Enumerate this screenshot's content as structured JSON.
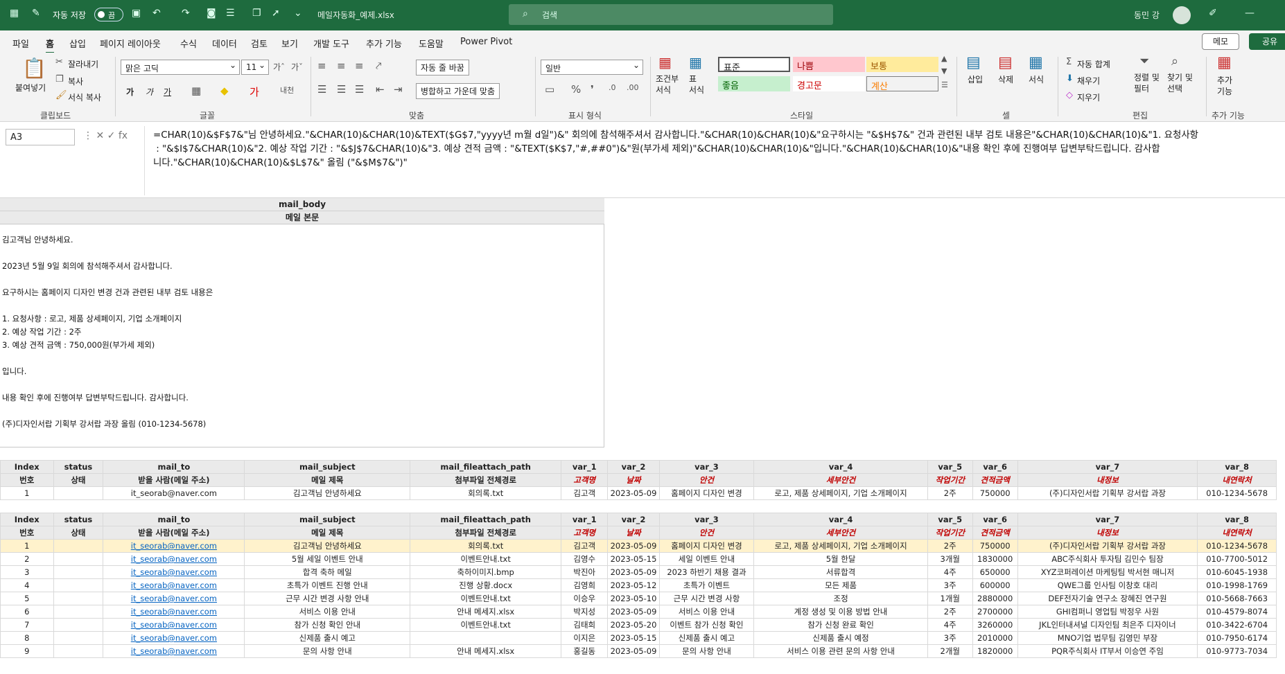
{
  "titlebar": {
    "autosave_label": "자동 저장",
    "autosave_state": "끔",
    "filename": "메일자동화_예제.xlsx",
    "search_placeholder": "검색",
    "user_name": "동민 강"
  },
  "menu": {
    "tabs": [
      "파일",
      "홈",
      "삽입",
      "페이지 레이아웃",
      "수식",
      "데이터",
      "검토",
      "보기",
      "개발 도구",
      "추가 기능",
      "도움말",
      "Power Pivot"
    ],
    "active": "홈",
    "memo_label": "메모",
    "share_label": "공유"
  },
  "ribbon": {
    "clipboard": {
      "paste": "붙여넣기",
      "cut": "잘라내기",
      "copy": "복사",
      "format_painter": "서식 복사",
      "group": "클립보드"
    },
    "font": {
      "name": "맑은 고딕",
      "size": "11",
      "bold": "가",
      "italic": "가",
      "underline": "가",
      "group": "글꼴"
    },
    "align": {
      "wrap": "자동 줄 바꿈",
      "merge": "병합하고 가운데 맞춤",
      "group": "맞춤"
    },
    "number": {
      "format": "일반",
      "group": "표시 형식"
    },
    "styles": {
      "cond": "조건부\n서식",
      "table": "표\n서식",
      "cells": [
        "표준",
        "나쁨",
        "보통",
        "좋음",
        "경고문",
        "계산"
      ],
      "group": "스타일"
    },
    "cells_group": {
      "insert": "삽입",
      "delete": "삭제",
      "format": "서식",
      "group": "셀"
    },
    "edit": {
      "autosum": "자동 합계",
      "fill": "채우기",
      "clear": "지우기",
      "sort": "정렬 및\n필터",
      "find": "찾기 및\n선택",
      "group": "편집"
    },
    "addins": {
      "label": "추가\n기능",
      "group": "추가 기능"
    }
  },
  "formula_bar": {
    "name_box": "A3",
    "formula_lines": [
      "=CHAR(10)&$F$7&\"님 안녕하세요.\"&CHAR(10)&CHAR(10)&TEXT($G$7,\"yyyy년 m월 d일\")&\" 회의에 참석해주셔서 감사합니다.\"&CHAR(10)&CHAR(10)&\"요구하시는 \"&$H$7&\" 건과 관련된 내부 검토 내용은\"&CHAR(10)&CHAR(10)&\"1. 요청사항 : \"&$I$7&CHAR(10)&\"2. 예상 작업 기간 : \"&$J$7&CHAR(10)&\"3. 예상 견적 금액 : \"&TEXT($K$7,\"#,##0\")&\"원(부가세 제외)\"&CHAR(10)&CHAR(10)&\"입니다.\"&CHAR(10)&CHAR(10)&\"내용 확인 후에 진행여부 답변부탁드립니다. 감사합니다.\"&CHAR(10)&CHAR(10)&$L$7&\" 올림 (\"&$M$7&\")\""
    ]
  },
  "mail_body": {
    "header1": "mail_body",
    "header2": "메일 본문",
    "lines": [
      "김고객님 안녕하세요.",
      "",
      "2023년 5월 9일 회의에 참석해주셔서 감사합니다.",
      "",
      "요구하시는 홈페이지 디자인 변경 건과 관련된 내부 검토 내용은",
      "",
      "1. 요청사항 : 로고, 제품 상세페이지, 기업 소개페이지",
      "2. 예상 작업 기간 : 2주",
      "3. 예상 견적 금액 : 750,000원(부가세 제외)",
      "",
      "입니다.",
      "",
      "내용 확인 후에 진행여부 답변부탁드립니다. 감사합니다.",
      "",
      "(주)디자인서랍 기획부 강서랍 과장 올림 (010-1234-5678)"
    ]
  },
  "columns": {
    "h1": [
      "Index",
      "status",
      "mail_to",
      "mail_subject",
      "mail_fileattach_path",
      "var_1",
      "var_2",
      "var_3",
      "var_4",
      "var_5",
      "var_6",
      "var_7",
      "var_8"
    ],
    "h2": [
      "번호",
      "상태",
      "받을 사람(메일 주소)",
      "메일 제목",
      "첨부파일 전체경로",
      "고객명",
      "날짜",
      "안건",
      "세부안건",
      "작업기간",
      "견적금액",
      "내정보",
      "내연락처"
    ]
  },
  "table1_rows": [
    [
      "1",
      "",
      "it_seorab@naver.com",
      "김고객님 안녕하세요",
      "회의록.txt",
      "김고객",
      "2023-05-09",
      "홈페이지 디자인 변경",
      "로고, 제품 상세페이지, 기업 소개페이지",
      "2주",
      "750000",
      "(주)디자인서랍 기획부 강서랍 과장",
      "010-1234-5678"
    ]
  ],
  "table2_rows": [
    [
      "1",
      "",
      "it_seorab@naver.com",
      "김고객님 안녕하세요",
      "회의록.txt",
      "김고객",
      "2023-05-09",
      "홈페이지 디자인 변경",
      "로고, 제품 상세페이지, 기업 소개페이지",
      "2주",
      "750000",
      "(주)디자인서랍 기획부 강서랍 과장",
      "010-1234-5678"
    ],
    [
      "2",
      "",
      "it_seorab@naver.com",
      "5월 세일 이벤트 안내",
      "이벤트안내.txt",
      "김영수",
      "2023-05-15",
      "세일 이벤트 안내",
      "5월 한달",
      "3개월",
      "1830000",
      "ABC주식회사 투자팀 김민수 팀장",
      "010-7700-5012"
    ],
    [
      "3",
      "",
      "it_seorab@naver.com",
      "합격 축하 메일",
      "축하이미지.bmp",
      "박진아",
      "2023-05-09",
      "2023 하반기 채용 결과",
      "서류합격",
      "4주",
      "650000",
      "XYZ코퍼레이션 마케팅팀 박서현 매니저",
      "010-6045-1938"
    ],
    [
      "4",
      "",
      "it_seorab@naver.com",
      "초특가 이벤트 진행 안내",
      "진행 상황.docx",
      "김영희",
      "2023-05-12",
      "초특가 이벤트",
      "모든 제품",
      "3주",
      "600000",
      "QWE그룹 인사팀 이창호 대리",
      "010-1998-1769"
    ],
    [
      "5",
      "",
      "it_seorab@naver.com",
      "근무 시간 변경 사항 안내",
      "이벤트안내.txt",
      "이승우",
      "2023-05-10",
      "근무 시간 변경 사항",
      "조정",
      "1개월",
      "2880000",
      "DEF전자기술 연구소 장혜진 연구원",
      "010-5668-7663"
    ],
    [
      "6",
      "",
      "it_seorab@naver.com",
      "서비스 이용 안내",
      "안내 메세지.xlsx",
      "박지성",
      "2023-05-09",
      "서비스 이용 안내",
      "계정 생성 및 이용 방법 안내",
      "2주",
      "2700000",
      "GHI컴퍼니 영업팀 박정우 사원",
      "010-4579-8074"
    ],
    [
      "7",
      "",
      "it_seorab@naver.com",
      "참가 신청 확인 안내",
      "이벤트안내.txt",
      "김태희",
      "2023-05-20",
      "이벤트 참가 신청 확인",
      "참가 신청 완료 확인",
      "4주",
      "3260000",
      "JKL인터내셔널 디자인팀 최은주 디자이너",
      "010-3422-6704"
    ],
    [
      "8",
      "",
      "it_seorab@naver.com",
      "신제품 출시 예고",
      "",
      "이지은",
      "2023-05-15",
      "신제품 출시 예고",
      "신제품 출시 예정",
      "3주",
      "2010000",
      "MNO기업 법무팀 김영민 부장",
      "010-7950-6174"
    ],
    [
      "9",
      "",
      "it_seorab@naver.com",
      "문의 사항 안내",
      "안내 메세지.xlsx",
      "홍길동",
      "2023-05-09",
      "문의 사항 안내",
      "서비스 이용 관련 문의 사항 안내",
      "2개월",
      "1820000",
      "PQR주식회사 IT부서 이승연 주임",
      "010-9773-7034"
    ]
  ]
}
